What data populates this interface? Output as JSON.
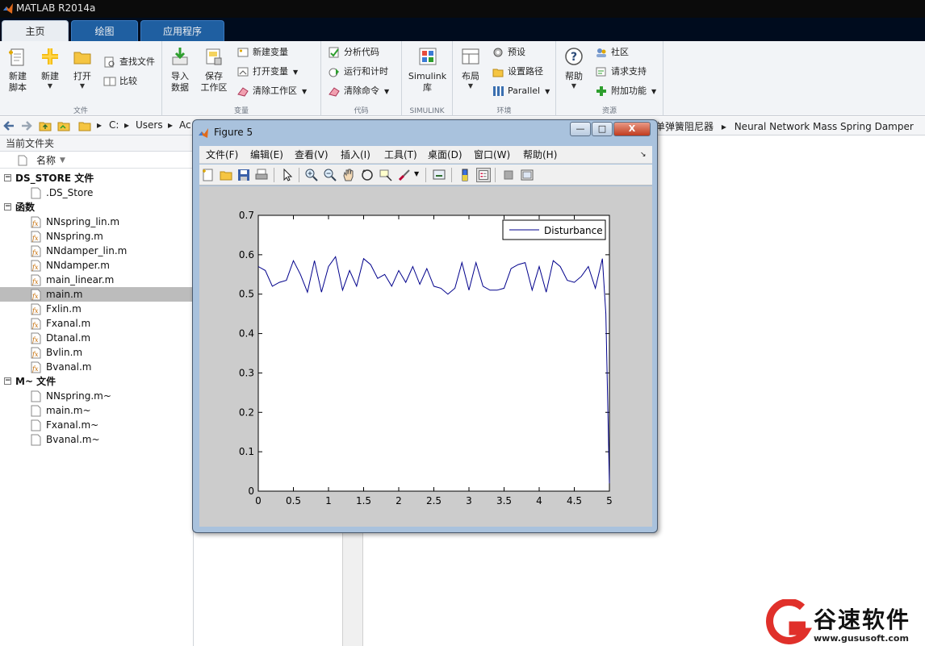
{
  "window": {
    "title": "MATLAB R2014a"
  },
  "tabs": [
    {
      "label": "主页",
      "active": true
    },
    {
      "label": "绘图",
      "active": false
    },
    {
      "label": "应用程序",
      "active": false
    }
  ],
  "ribbon": {
    "file": {
      "label": "文件",
      "new_script": "新建\n脚本",
      "new_script_l1": "新建",
      "new_script_l2": "脚本",
      "new": "新建",
      "open": "打开",
      "find_files": "查找文件",
      "compare": "比较"
    },
    "variable": {
      "label": "变量",
      "import_l1": "导入",
      "import_l2": "数据",
      "save_l1": "保存",
      "save_l2": "工作区",
      "new_var": "新建变量",
      "open_var": "打开变量",
      "clear_ws": "清除工作区"
    },
    "code": {
      "label": "代码",
      "analyze": "分析代码",
      "run_time": "运行和计时",
      "clear_cmd": "清除命令"
    },
    "simulink": {
      "label": "SIMULINK",
      "lib_l1": "Simulink",
      "lib_l2": "库"
    },
    "environment": {
      "label": "环境",
      "layout": "布局",
      "preferences": "预设",
      "set_path": "设置路径",
      "parallel": "Parallel"
    },
    "resources": {
      "label": "资源",
      "help": "帮助",
      "community": "社区",
      "request_support": "请求支持",
      "addons": "附加功能"
    }
  },
  "address": {
    "drive": "C:",
    "users": "Users",
    "partial": "Ac",
    "folder_tail": "单弹簧阻尼器",
    "folder_last": "Neural Network Mass Spring Damper"
  },
  "folder_panel": {
    "title": "当前文件夹",
    "column": "名称",
    "groups": [
      {
        "name": "DS_STORE 文件",
        "files": [
          ".DS_Store"
        ]
      },
      {
        "name": "函数",
        "files": [
          "NNspring_lin.m",
          "NNspring.m",
          "NNdamper_lin.m",
          "NNdamper.m",
          "main_linear.m",
          "main.m",
          "Fxlin.m",
          "Fxanal.m",
          "Dtanal.m",
          "Bvlin.m",
          "Bvanal.m"
        ]
      },
      {
        "name": "M~ 文件",
        "files": [
          "NNspring.m~",
          "main.m~",
          "Fxanal.m~",
          "Bvanal.m~"
        ]
      }
    ],
    "selected_file": "main.m"
  },
  "figure": {
    "title": "Figure 5",
    "menu": [
      "文件(F)",
      "编辑(E)",
      "查看(V)",
      "插入(I)",
      "工具(T)",
      "桌面(D)",
      "窗口(W)",
      "帮助(H)"
    ],
    "minimize": "—",
    "maximize": "□",
    "close": "X"
  },
  "chart_data": {
    "type": "line",
    "title": "",
    "xlabel": "",
    "ylabel": "",
    "xlim": [
      0,
      5
    ],
    "ylim": [
      0,
      0.7
    ],
    "xticks": [
      "0",
      "0.5",
      "1",
      "1.5",
      "2",
      "2.5",
      "3",
      "3.5",
      "4",
      "4.5",
      "5"
    ],
    "yticks": [
      "0",
      "0.1",
      "0.2",
      "0.3",
      "0.4",
      "0.5",
      "0.6",
      "0.7"
    ],
    "legend": {
      "placement": "top-right",
      "entries": [
        "Disturbance"
      ]
    },
    "grid": false,
    "series": [
      {
        "name": "Disturbance",
        "color": "#00008b",
        "x": [
          0,
          0.1,
          0.2,
          0.3,
          0.4,
          0.5,
          0.6,
          0.7,
          0.8,
          0.9,
          1.0,
          1.1,
          1.2,
          1.3,
          1.4,
          1.5,
          1.6,
          1.7,
          1.8,
          1.9,
          2.0,
          2.1,
          2.2,
          2.3,
          2.4,
          2.5,
          2.6,
          2.7,
          2.8,
          2.9,
          3.0,
          3.1,
          3.2,
          3.3,
          3.4,
          3.5,
          3.6,
          3.7,
          3.8,
          3.9,
          4.0,
          4.1,
          4.2,
          4.3,
          4.4,
          4.5,
          4.6,
          4.7,
          4.8,
          4.9,
          4.95,
          5.0
        ],
        "y": [
          0.57,
          0.56,
          0.52,
          0.53,
          0.535,
          0.585,
          0.55,
          0.505,
          0.585,
          0.505,
          0.57,
          0.595,
          0.51,
          0.56,
          0.52,
          0.59,
          0.575,
          0.54,
          0.55,
          0.52,
          0.56,
          0.53,
          0.57,
          0.525,
          0.565,
          0.52,
          0.515,
          0.5,
          0.515,
          0.58,
          0.51,
          0.58,
          0.52,
          0.51,
          0.51,
          0.515,
          0.565,
          0.575,
          0.58,
          0.51,
          0.57,
          0.505,
          0.585,
          0.57,
          0.535,
          0.53,
          0.545,
          0.57,
          0.515,
          0.59,
          0.45,
          0.02
        ]
      }
    ]
  },
  "watermark": {
    "text": "谷速软件",
    "url": "www.gususoft.com"
  },
  "colors": {
    "ribbon_bg": "#f2f4f7",
    "tab_active": "#e9edf2",
    "tab_inactive": "#1f5fa1",
    "figure_frame": "#a9c2dd",
    "plot_line": "#00008b"
  }
}
